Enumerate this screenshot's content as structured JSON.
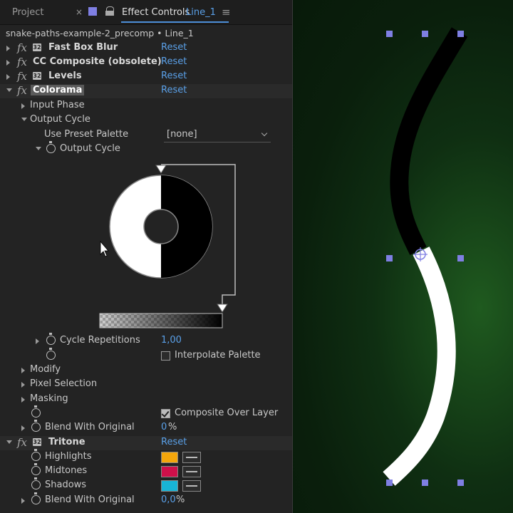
{
  "tabs": {
    "project": "Project",
    "close_glyph": "×",
    "effect_controls": "Effect Controls",
    "layer": "Line_1",
    "menu_glyph": "≡"
  },
  "breadcrumb": "snake-paths-example-2_precomp • Line_1",
  "effects": {
    "fast_box_blur": {
      "name": "Fast Box Blur",
      "reset": "Reset"
    },
    "cc_composite": {
      "name": "CC Composite (obsolete)",
      "reset": "Reset"
    },
    "levels": {
      "name": "Levels",
      "reset": "Reset"
    },
    "colorama": {
      "name": "Colorama",
      "reset": "Reset",
      "input_phase": "Input Phase",
      "output_cycle_group": "Output Cycle",
      "use_preset_palette": "Use Preset Palette",
      "preset_value": "[none]",
      "output_cycle": "Output Cycle",
      "cycle_repetitions": "Cycle Repetitions",
      "cycle_repetitions_value": "1,00",
      "interpolate_palette": "Interpolate Palette",
      "modify": "Modify",
      "pixel_selection": "Pixel Selection",
      "masking": "Masking",
      "composite_over_layer": "Composite Over Layer",
      "blend_with_original": "Blend With Original",
      "blend_value": "0",
      "blend_unit": "%"
    },
    "tritone": {
      "name": "Tritone",
      "reset": "Reset",
      "highlights": "Highlights",
      "midtones": "Midtones",
      "shadows": "Shadows",
      "blend_with_original": "Blend With Original",
      "blend_value": "0,0",
      "blend_unit": "%"
    }
  },
  "colors": {
    "highlights": "#f4a60c",
    "midtones": "#d0104a",
    "shadows": "#18b4d6",
    "accent": "#5aa0e8",
    "handle": "#7f7fe3"
  },
  "icons": {
    "badge": "layer-effect-badge-icon",
    "stopwatch": "stopwatch-icon",
    "eyedropper": "eyedropper-icon"
  }
}
